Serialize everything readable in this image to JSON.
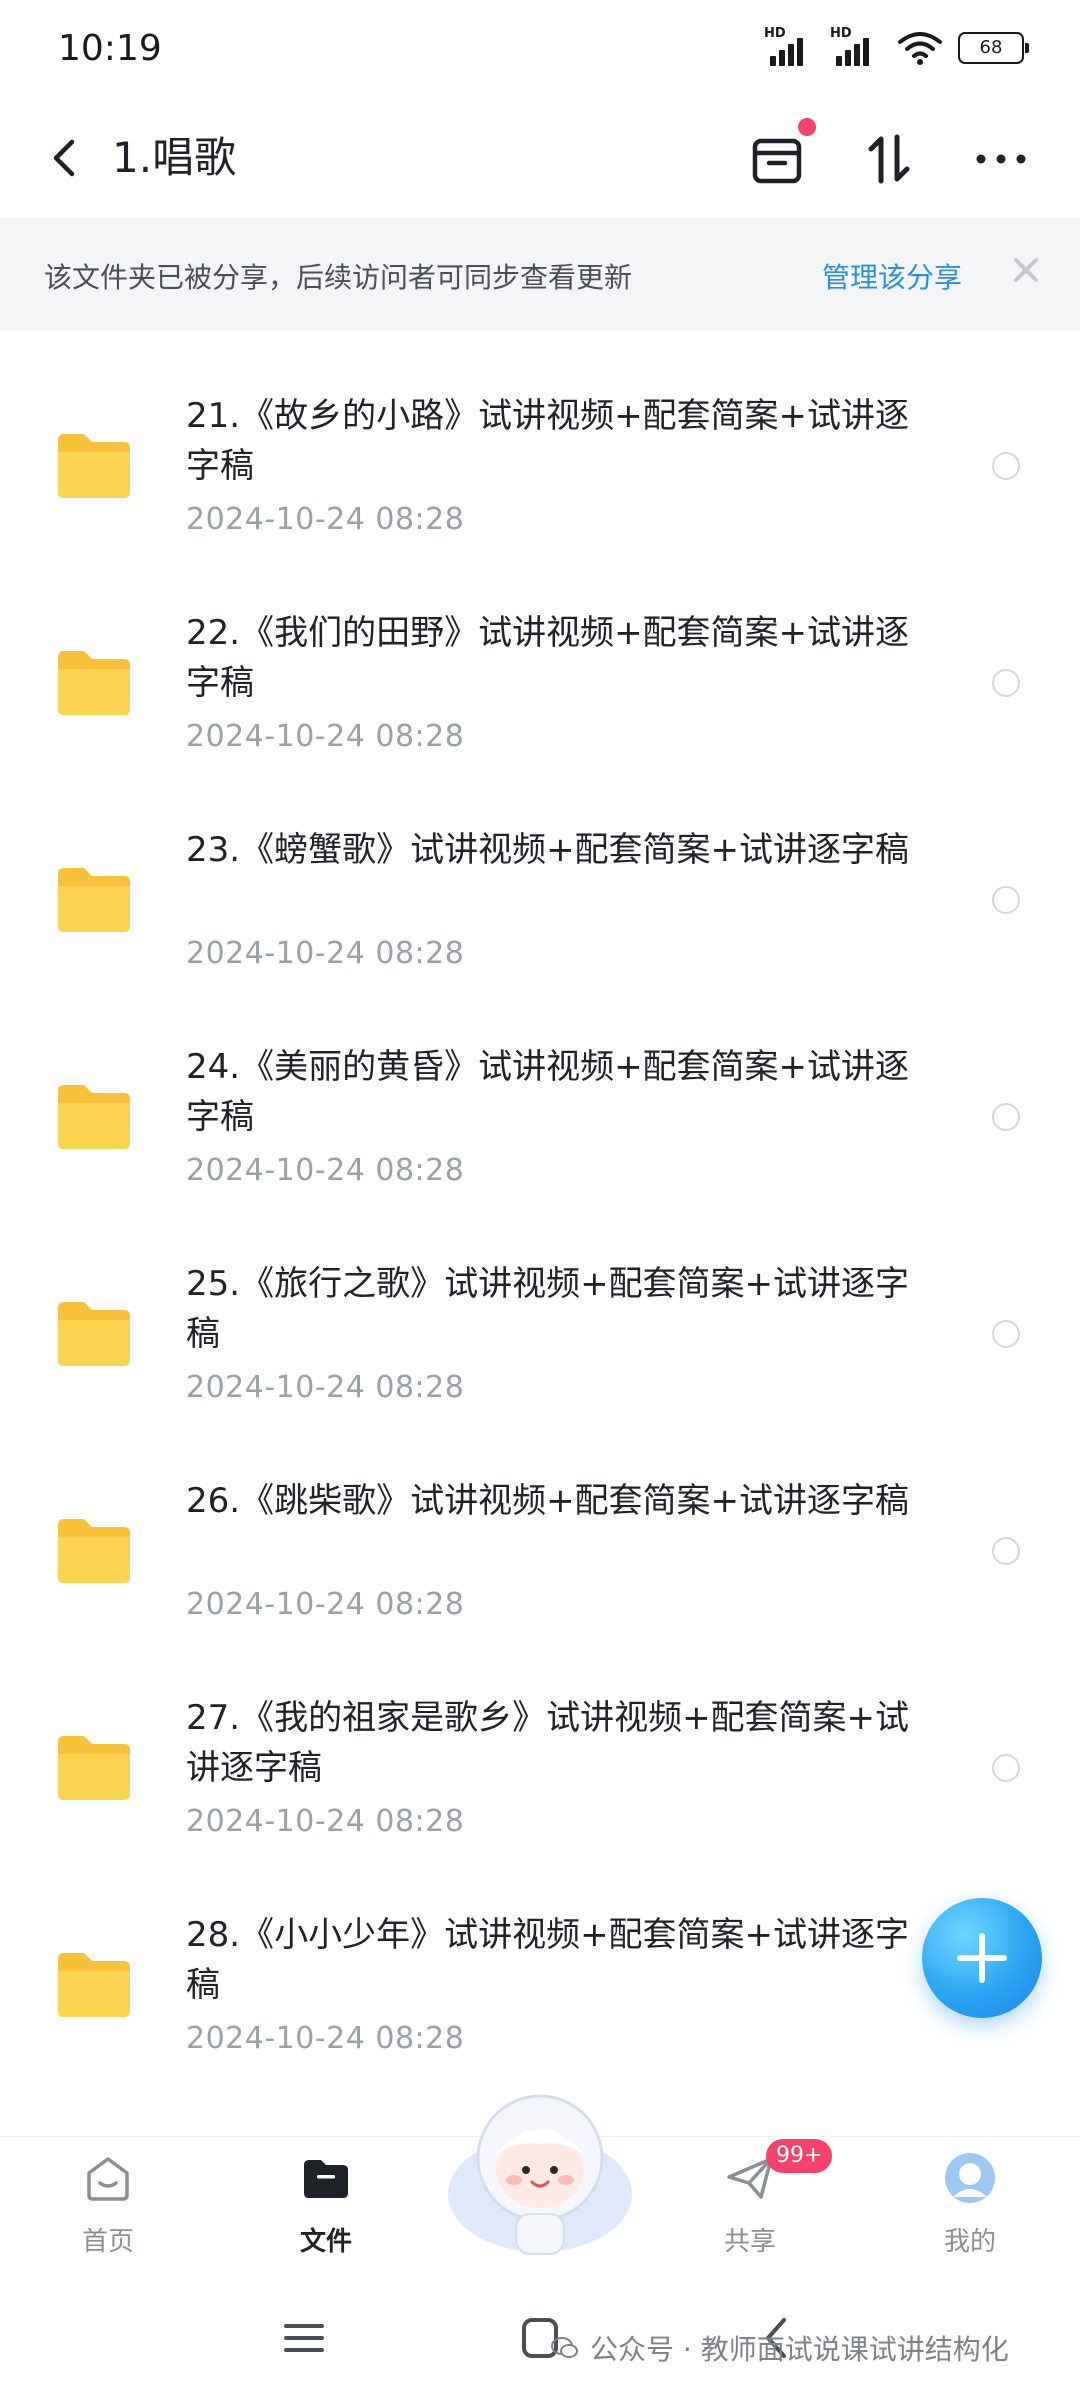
{
  "status_bar": {
    "time": "10:19",
    "hd1": "HD",
    "hd2": "HD",
    "battery": "68"
  },
  "header": {
    "title": "1.唱歌"
  },
  "share_banner": {
    "text": "该文件夹已被分享，后续访问者可同步查看更新",
    "manage_label": "管理该分享"
  },
  "files": [
    {
      "name": "21.《故乡的小路》试讲视频+配套简案+试讲逐字稿",
      "date": "2024-10-24  08:28"
    },
    {
      "name": "22.《我们的田野》试讲视频+配套简案+试讲逐字稿",
      "date": "2024-10-24  08:28"
    },
    {
      "name": "23.《螃蟹歌》试讲视频+配套简案+试讲逐字稿",
      "date": "2024-10-24  08:28"
    },
    {
      "name": "24.《美丽的黄昏》试讲视频+配套简案+试讲逐字稿",
      "date": "2024-10-24  08:28"
    },
    {
      "name": "25.《旅行之歌》试讲视频+配套简案+试讲逐字稿",
      "date": "2024-10-24  08:28"
    },
    {
      "name": "26.《跳柴歌》试讲视频+配套简案+试讲逐字稿",
      "date": "2024-10-24  08:28"
    },
    {
      "name": "27.《我的祖家是歌乡》试讲视频+配套简案+试讲逐字稿",
      "date": "2024-10-24  08:28"
    },
    {
      "name": "28.《小小少年》试讲视频+配套简案+试讲逐字稿",
      "date": "2024-10-24  08:28"
    }
  ],
  "bottom_nav": {
    "home": "首页",
    "files": "文件",
    "share": "共享",
    "share_badge": "99+",
    "me": "我的"
  },
  "watermark": {
    "text": "公众号 · 教师面试说课试讲结构化"
  },
  "colors": {
    "accent": "#2b8fe0",
    "folder": "#f9c93c",
    "badge": "#f5426c"
  }
}
